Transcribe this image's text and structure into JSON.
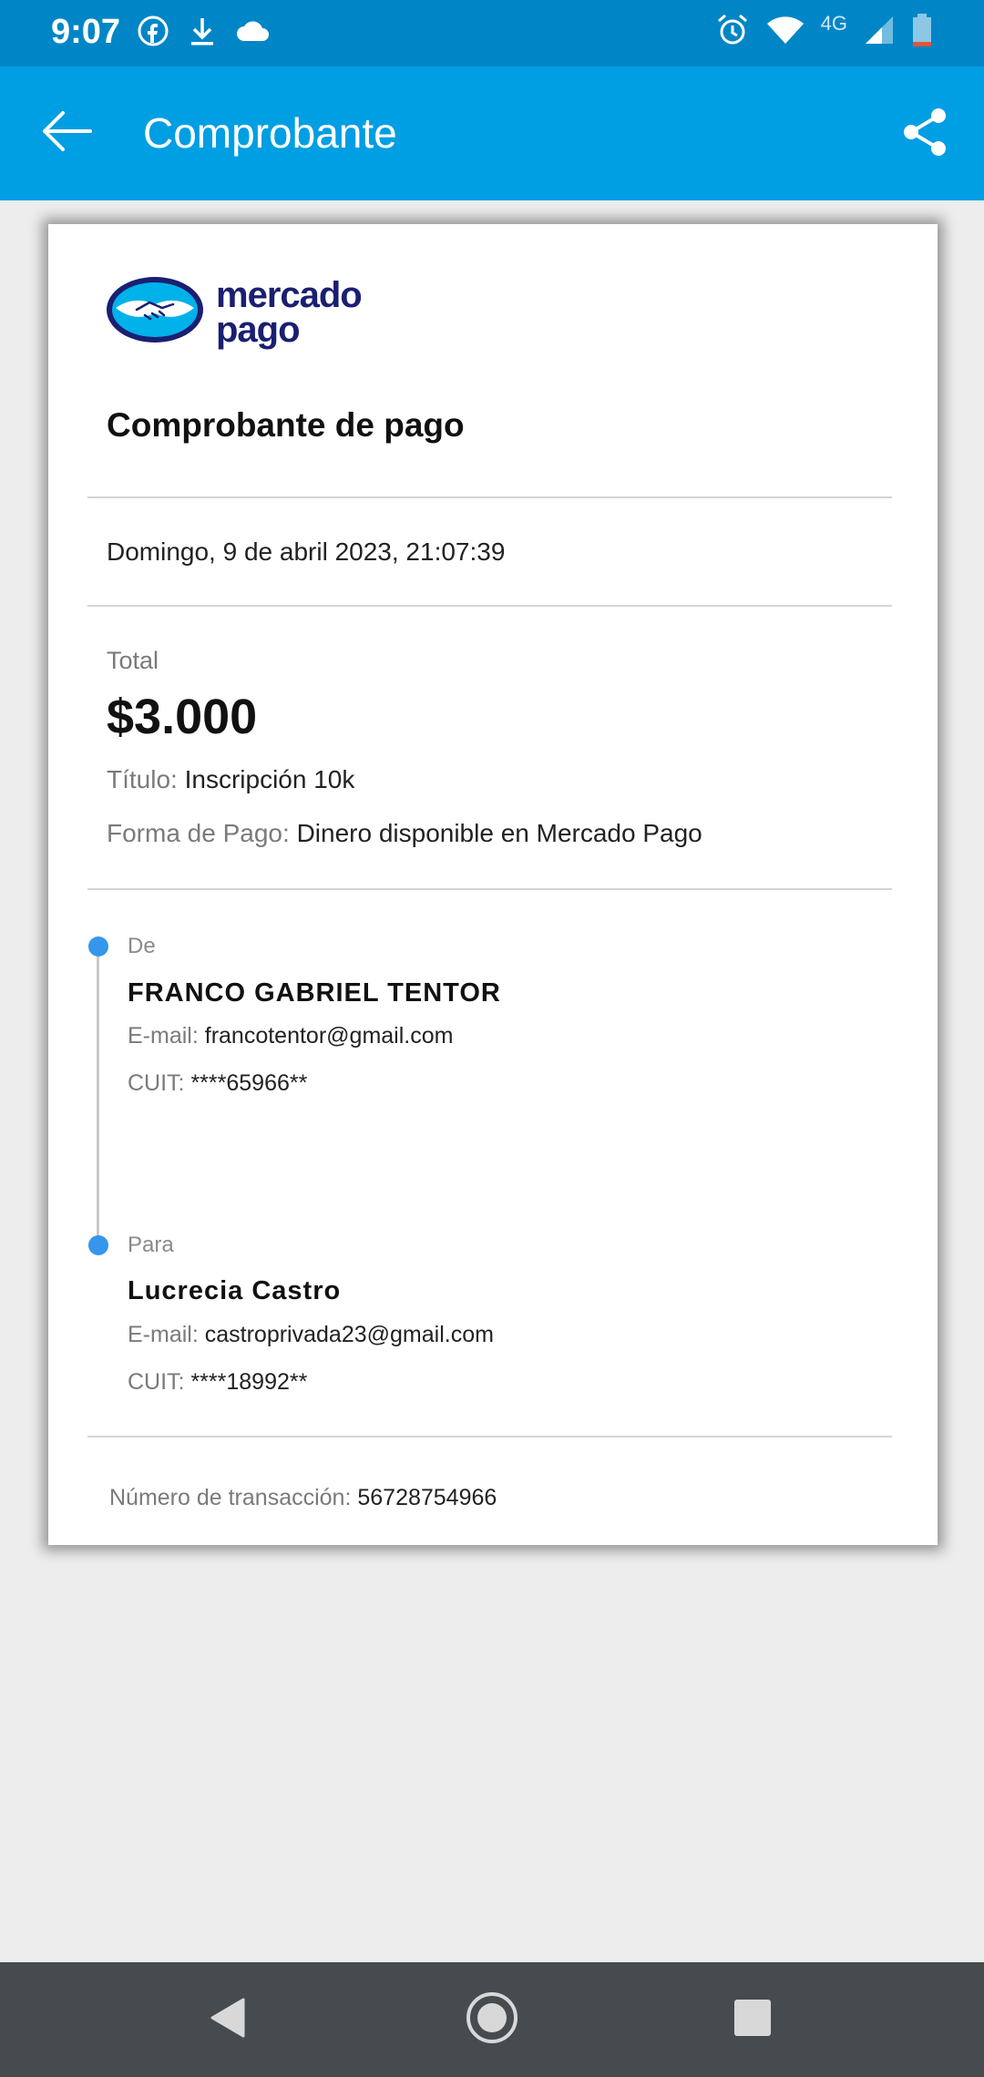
{
  "status_bar": {
    "time": "9:07",
    "network_label": "4G",
    "icons": [
      "facebook-icon",
      "download-icon",
      "cloud-icon",
      "alarm-icon",
      "wifi-icon",
      "signal-icon",
      "battery-icon"
    ]
  },
  "app_bar": {
    "title": "Comprobante",
    "back_icon": "arrow-left-icon",
    "share_icon": "share-icon"
  },
  "receipt": {
    "logo_line1": "mercado",
    "logo_line2": "pago",
    "title": "Comprobante de pago",
    "date": "Domingo, 9 de abril 2023, 21:07:39",
    "total_label": "Total",
    "total_amount": "$3.000",
    "titulo_key": "Título:",
    "titulo_value": "Inscripción 10k",
    "forma_key": "Forma de Pago:",
    "forma_value": "Dinero disponible en Mercado Pago",
    "from": {
      "label": "De",
      "name": "FRANCO GABRIEL TENTOR",
      "email_key": "E-mail:",
      "email": "francotentor@gmail.com",
      "cuit_key": "CUIT:",
      "cuit": "****65966**"
    },
    "to": {
      "label": "Para",
      "name": "Lucrecia Castro",
      "email_key": "E-mail:",
      "email": "castroprivada23@gmail.com",
      "cuit_key": "CUIT:",
      "cuit": "****18992**"
    },
    "transaction_key": "Número de transacción:",
    "transaction_value": "56728754966"
  },
  "nav_bar": {
    "icons": [
      "back-triangle-icon",
      "home-circle-icon",
      "recents-square-icon"
    ]
  },
  "colors": {
    "status_bar": "#0086c6",
    "app_bar": "#009ee3",
    "timeline_dot": "#3596ec",
    "logo_text": "#1a1f71",
    "nav_bar": "#464b4f",
    "background": "#ededed"
  }
}
